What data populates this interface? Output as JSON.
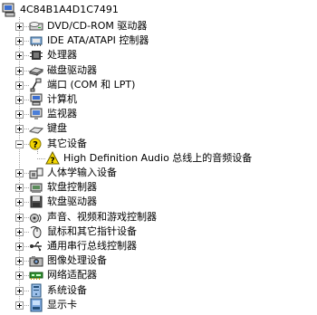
{
  "root": {
    "label": "4C84B1A4D1C7491",
    "icon": "computer-icon"
  },
  "items": [
    {
      "label": "DVD/CD-ROM 驱动器",
      "icon": "dvd-drive-icon",
      "expanded": false
    },
    {
      "label": "IDE ATA/ATAPI 控制器",
      "icon": "ide-controller-icon",
      "expanded": false
    },
    {
      "label": "处理器",
      "icon": "processor-icon",
      "expanded": false
    },
    {
      "label": "磁盘驱动器",
      "icon": "disk-drive-icon",
      "expanded": false
    },
    {
      "label": "端口 (COM 和 LPT)",
      "icon": "port-icon",
      "expanded": false
    },
    {
      "label": "计算机",
      "icon": "computer-icon",
      "expanded": false
    },
    {
      "label": "监视器",
      "icon": "monitor-icon",
      "expanded": false
    },
    {
      "label": "键盘",
      "icon": "keyboard-icon",
      "expanded": false
    },
    {
      "label": "其它设备",
      "icon": "unknown-device-icon",
      "expanded": true,
      "children": [
        {
          "label": "High Definition Audio 总线上的音频设备",
          "icon": "warning-device-icon"
        }
      ]
    },
    {
      "label": "人体学输入设备",
      "icon": "hid-icon",
      "expanded": false
    },
    {
      "label": "软盘控制器",
      "icon": "floppy-controller-icon",
      "expanded": false
    },
    {
      "label": "软盘驱动器",
      "icon": "floppy-drive-icon",
      "expanded": false
    },
    {
      "label": "声音、视频和游戏控制器",
      "icon": "sound-icon",
      "expanded": false
    },
    {
      "label": "鼠标和其它指针设备",
      "icon": "mouse-icon",
      "expanded": false
    },
    {
      "label": "通用串行总线控制器",
      "icon": "usb-icon",
      "expanded": false
    },
    {
      "label": "图像处理设备",
      "icon": "imaging-device-icon",
      "expanded": false
    },
    {
      "label": "网络适配器",
      "icon": "network-adapter-icon",
      "expanded": false
    },
    {
      "label": "系统设备",
      "icon": "system-device-icon",
      "expanded": false
    },
    {
      "label": "显示卡",
      "icon": "display-adapter-icon",
      "expanded": false
    }
  ]
}
